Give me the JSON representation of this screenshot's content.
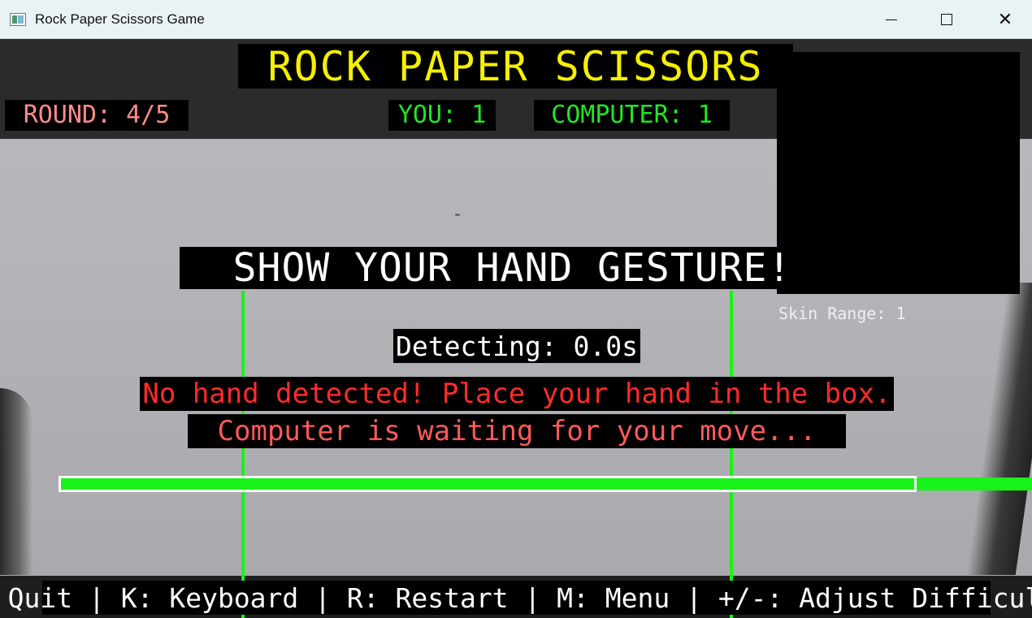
{
  "window": {
    "title": "Rock Paper Scissors Game",
    "controls": {
      "minimize_icon": "minimize-icon",
      "maximize_icon": "maximize-icon",
      "close_icon": "close-icon",
      "close_glyph": "✕"
    }
  },
  "game": {
    "title": "ROCK PAPER SCISSORS",
    "round": "ROUND: 4/5",
    "you_score": "YOU: 1",
    "computer_score": "COMPUTER: 1",
    "prompt": "SHOW YOUR HAND GESTURE!",
    "skin_range": "Skin Range: 1",
    "detecting": "Detecting: 0.0s",
    "message_line1": "No hand detected! Place your hand in the box.",
    "message_line2": "Computer is waiting for your move...",
    "hints": "Q: Quit | K: Keyboard | R: Restart | M: Menu | +/-: Adjust Difficulty",
    "progress_fraction": 1.0
  },
  "colors": {
    "title_yellow": "#f5f000",
    "round_pink": "#ff8c8c",
    "score_green": "#22e622",
    "guide_green": "#19f219",
    "message_red": "#ff2b2b"
  }
}
